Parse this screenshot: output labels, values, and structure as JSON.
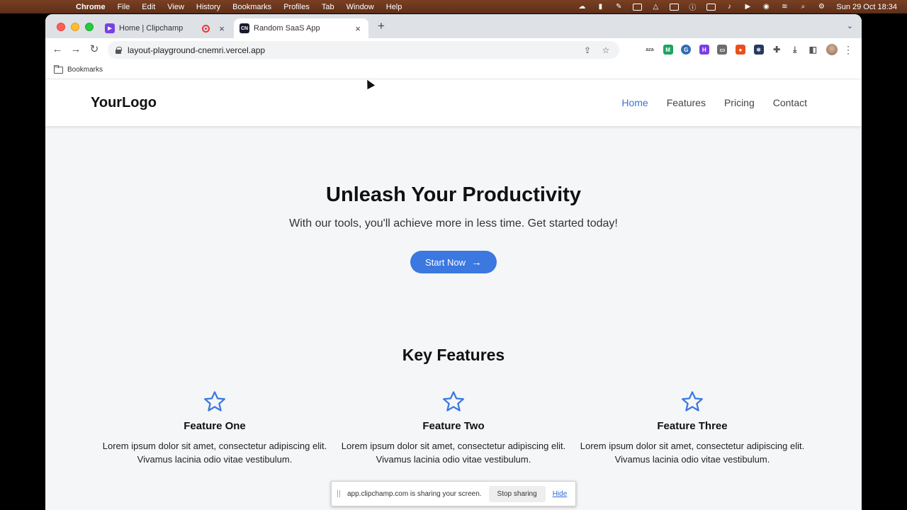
{
  "menubar": {
    "app_name": "Chrome",
    "items": [
      "File",
      "Edit",
      "View",
      "History",
      "Bookmarks",
      "Profiles",
      "Tab",
      "Window",
      "Help"
    ],
    "clock": "Sun 29 Oct  18:34",
    "status_icons": [
      "creative-cloud-icon",
      "acrobat-icon",
      "pen-icon",
      "battery-icon",
      "triangle-icon",
      "amazon-icon",
      "info-icon",
      "keyboard-input-icon",
      "volume-icon",
      "play-icon",
      "screen-record-icon",
      "wifi-icon",
      "search-icon",
      "control-center-icon"
    ]
  },
  "browser": {
    "tabs": [
      {
        "title": "Home | Clipchamp",
        "favicon_color": "#7b3fe4",
        "recording": true
      },
      {
        "title": "Random SaaS App",
        "favicon_text": "CN",
        "favicon_color": "#1a1a2e"
      }
    ],
    "url": "layout-playground-cnemri.vercel.app",
    "bookmarks_label": "Bookmarks",
    "extension_colors": [
      "#555555",
      "#1ea362",
      "#2f6db5",
      "#7b3fe4",
      "#6d6d6d",
      "#e8501f",
      "#233a63",
      "#555555",
      "#555555",
      "#555555"
    ]
  },
  "site": {
    "logo": "YourLogo",
    "nav": [
      {
        "label": "Home",
        "active": true
      },
      {
        "label": "Features",
        "active": false
      },
      {
        "label": "Pricing",
        "active": false
      },
      {
        "label": "Contact",
        "active": false
      }
    ],
    "hero": {
      "title": "Unleash Your Productivity",
      "subtitle": "With our tools, you'll achieve more in less time. Get started today!",
      "cta_label": "Start Now",
      "cta_arrow": "→"
    },
    "features_heading": "Key Features",
    "features": [
      {
        "title": "Feature One",
        "description": "Lorem ipsum dolor sit amet, consectetur adipiscing elit. Vivamus lacinia odio vitae vestibulum."
      },
      {
        "title": "Feature Two",
        "description": "Lorem ipsum dolor sit amet, consectetur adipiscing elit. Vivamus lacinia odio vitae vestibulum."
      },
      {
        "title": "Feature Three",
        "description": "Lorem ipsum dolor sit amet, consectetur adipiscing elit. Vivamus lacinia odio vitae vestibulum."
      }
    ],
    "accent_color": "#3b78e0"
  },
  "share_bar": {
    "message": "app.clipchamp.com is sharing your screen.",
    "stop_label": "Stop sharing",
    "hide_label": "Hide"
  }
}
